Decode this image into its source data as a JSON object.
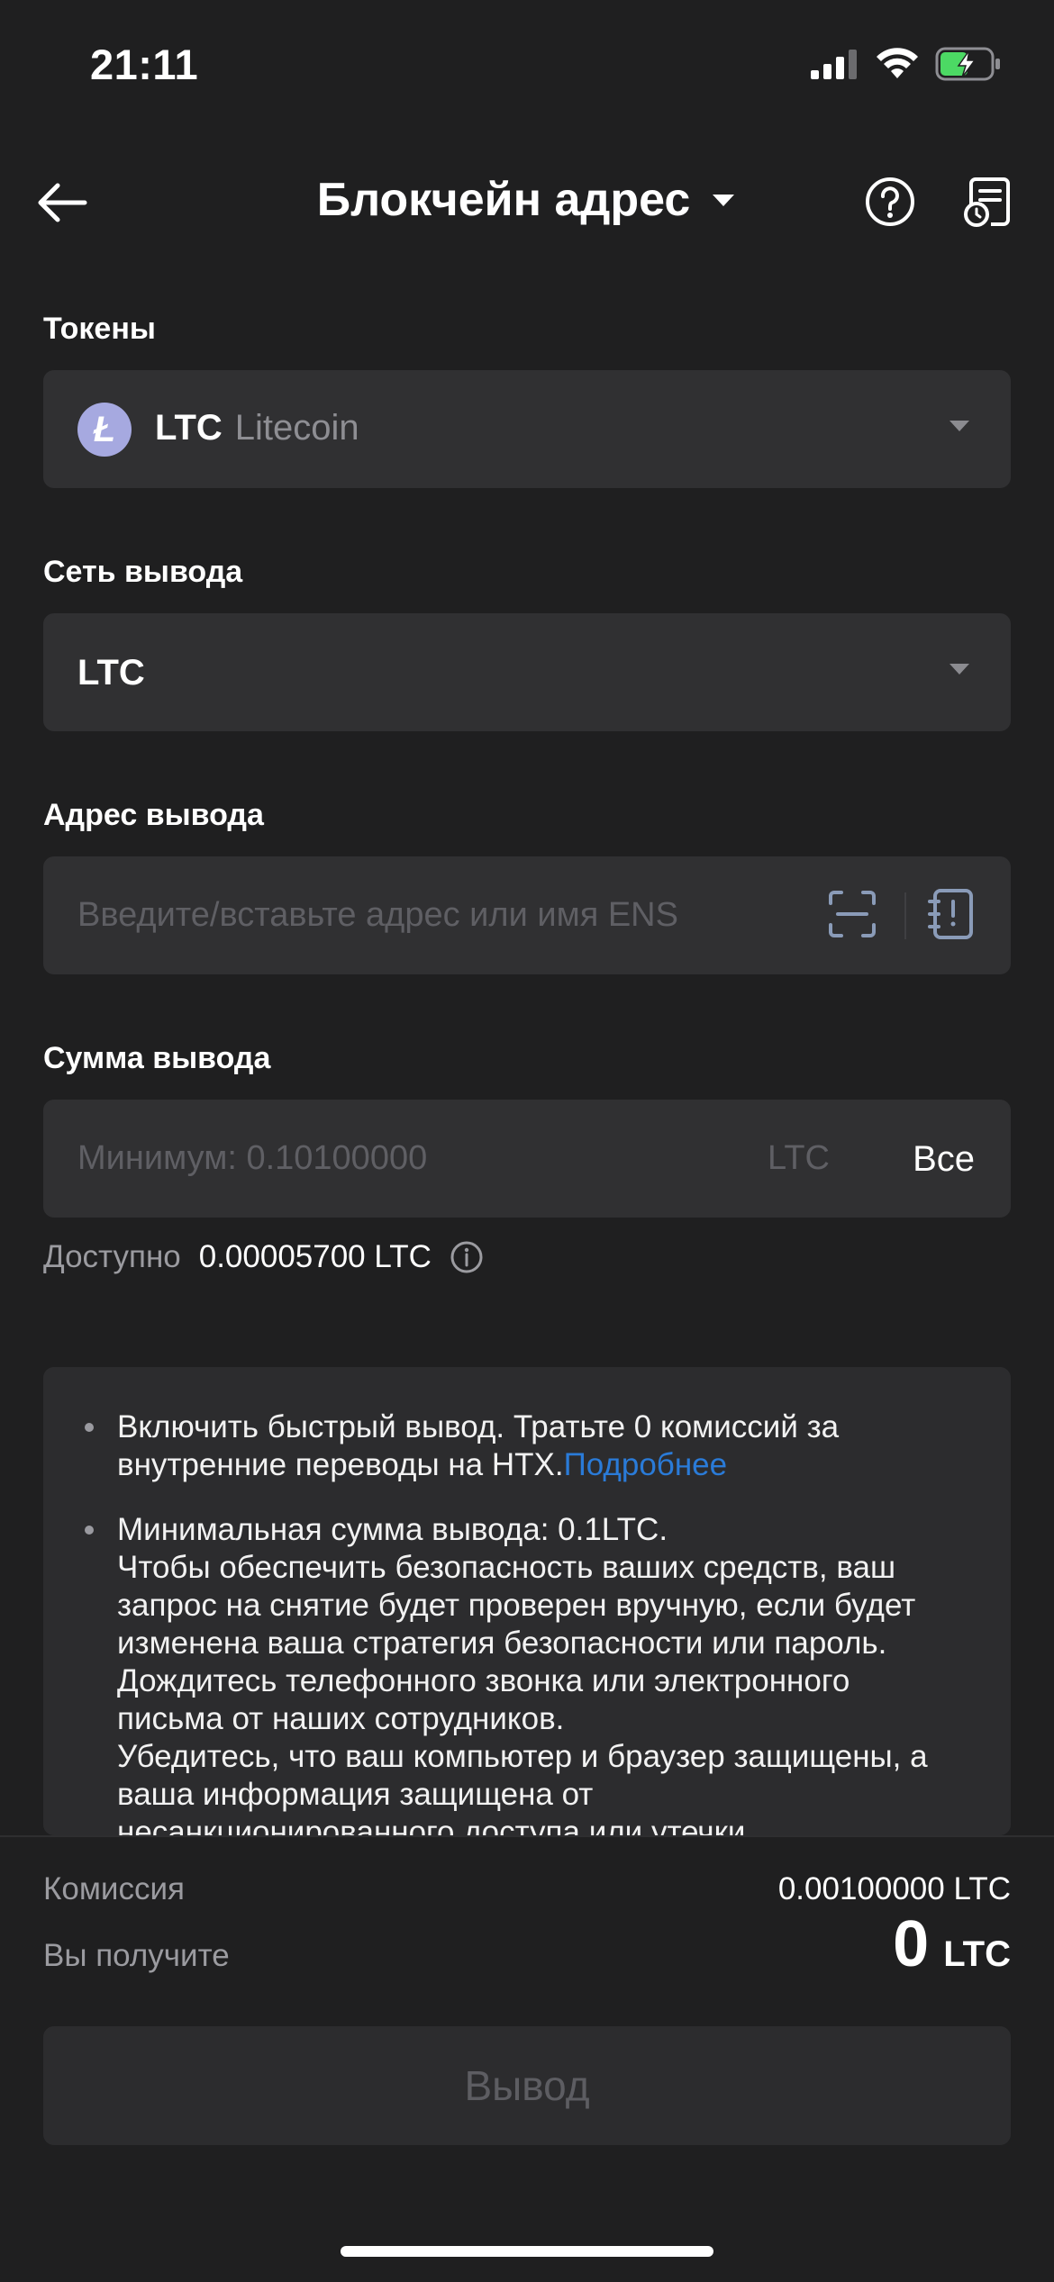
{
  "status_bar": {
    "time": "21:11"
  },
  "header": {
    "title": "Блокчейн адрес"
  },
  "tokens": {
    "label": "Токены",
    "symbol": "LTC",
    "name": "Litecoin",
    "icon": "litecoin-icon"
  },
  "network": {
    "label": "Сеть вывода",
    "value": "LTC"
  },
  "address": {
    "label": "Адрес вывода",
    "placeholder": "Введите/вставьте адрес или имя ENS"
  },
  "amount": {
    "label": "Сумма вывода",
    "placeholder": "Минимум: 0.10100000",
    "unit": "LTC",
    "all_label": "Все"
  },
  "available": {
    "label": "Доступно",
    "value": "0.00005700 LTC"
  },
  "notice": {
    "item1_text": "Включить быстрый вывод. Тратьте 0 комиссий за внутренние переводы на HTX.",
    "item1_link": "Подробнее",
    "item2_lines": [
      "Минимальная сумма вывода: 0.1LTC.",
      "Чтобы обеспечить безопасность ваших средств, ваш",
      "запрос на снятие будет проверен вручную, если будет",
      "изменена ваша стратегия безопасности или пароль.",
      "Дождитесь телефонного звонка или электронного",
      "письма от наших сотрудников.",
      "Убедитесь, что ваш компьютер и браузер защищены, а",
      "ваша информация защищена от",
      "несанкционированного доступа или утечки."
    ]
  },
  "summary": {
    "fee_label": "Комиссия",
    "fee_value": "0.00100000 LTC",
    "receive_label": "Вы получите",
    "receive_value": "0",
    "receive_unit": "LTC"
  },
  "submit": {
    "label": "Вывод"
  },
  "colors": {
    "background": "#1f1f20",
    "field": "#303032",
    "link": "#2a7bd8",
    "battery": "#4cd964"
  }
}
